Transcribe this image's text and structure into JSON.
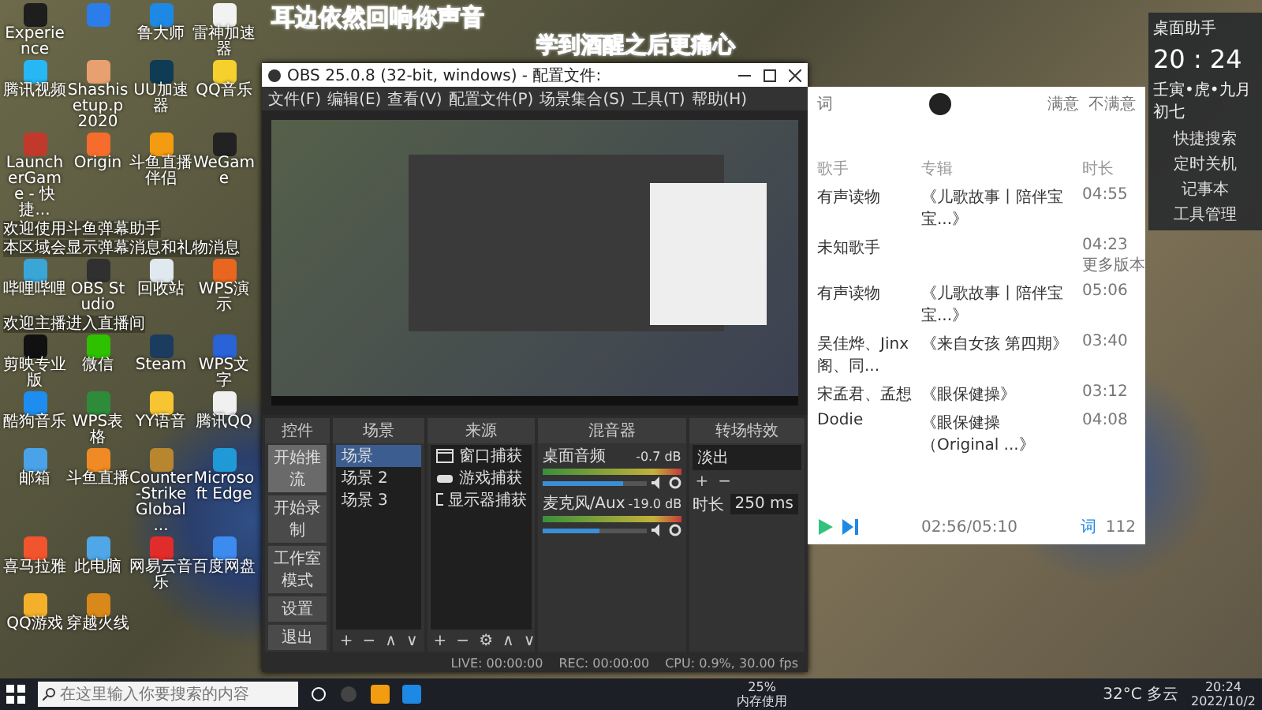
{
  "captions": [
    "耳边依然回响你声音",
    "学到酒醒之后更痛心"
  ],
  "desktop": {
    "sections": [
      {
        "kind": "icons",
        "icons": [
          {
            "label": "Experience",
            "color": "#1e1e1e"
          },
          {
            "color": "#2b7de9"
          },
          {
            "label": "鲁大师",
            "color": "#1e88e5"
          },
          {
            "label": "雷神加速器",
            "color": "#f2f2f2"
          },
          {
            "label": "腾讯视频",
            "color": "#27b7f5"
          },
          {
            "label": "Shashisetup.p 2020",
            "color": "#e8a070"
          },
          {
            "label": "UU加速器",
            "color": "#0f3b55"
          },
          {
            "label": "QQ音乐",
            "color": "#f6d12d"
          },
          {
            "label": "LauncherGame - 快捷...",
            "color": "#c0392b"
          },
          {
            "label": "Origin",
            "color": "#f56c2d"
          },
          {
            "label": "斗鱼直播伴侣",
            "color": "#f39c12"
          },
          {
            "label": "WeGame",
            "color": "#222222"
          }
        ]
      },
      {
        "kind": "notice",
        "text": "欢迎使用斗鱼弹幕助手"
      },
      {
        "kind": "notice",
        "text": "本区域会显示弹幕消息和礼物消息"
      },
      {
        "kind": "icons",
        "icons": [
          {
            "label": "哔哩哔哩",
            "color": "#3aa6d8"
          },
          {
            "label": "OBS Studio",
            "color": "#303030"
          },
          {
            "label": "回收站",
            "color": "#dfe9ef"
          },
          {
            "label": "WPS演示",
            "color": "#e8661f"
          }
        ]
      },
      {
        "kind": "notice",
        "text": "欢迎主播进入直播间"
      },
      {
        "kind": "icons",
        "icons": [
          {
            "label": "剪映专业版",
            "color": "#111111"
          },
          {
            "label": "微信",
            "color": "#2dc100"
          },
          {
            "label": "Steam",
            "color": "#1b3b5f"
          },
          {
            "label": "WPS文字",
            "color": "#2a62d8"
          },
          {
            "label": "酷狗音乐",
            "color": "#1d8df0"
          },
          {
            "label": "WPS表格",
            "color": "#2e8b3a"
          },
          {
            "label": "YY语音",
            "color": "#f7c531"
          },
          {
            "label": "腾讯QQ",
            "color": "#f0f0f0"
          },
          {
            "label": "邮箱",
            "color": "#4aa3e8"
          },
          {
            "label": "斗鱼直播",
            "color": "#f08a24"
          },
          {
            "label": "Counter-Strike Global ...",
            "color": "#b8862e"
          },
          {
            "label": "Microsoft Edge",
            "color": "#1f9ad6"
          },
          {
            "label": "喜马拉雅",
            "color": "#f2542d"
          },
          {
            "label": "此电脑",
            "color": "#4fa7e8"
          },
          {
            "label": "网易云音乐",
            "color": "#e22b2b"
          },
          {
            "label": "百度网盘",
            "color": "#3c8cf0"
          },
          {
            "label": "QQ游戏",
            "color": "#f4b02b"
          },
          {
            "label": "穿越火线",
            "color": "#d9881a"
          }
        ]
      }
    ]
  },
  "obs": {
    "title": "OBS 25.0.8 (32-bit, windows) - 配置文件:",
    "menu": [
      "文件(F)",
      "编辑(E)",
      "查看(V)",
      "配置文件(P)",
      "场景集合(S)",
      "工具(T)",
      "帮助(H)"
    ],
    "controls": {
      "title": "控件",
      "buttons": [
        {
          "label": "开始推流",
          "hovered": true
        },
        {
          "label": "开始录制",
          "hovered": false
        },
        {
          "label": "工作室模式",
          "hovered": false
        },
        {
          "label": "设置",
          "hovered": false
        },
        {
          "label": "退出",
          "hovered": false
        }
      ]
    },
    "scenes": {
      "title": "场景",
      "items": [
        {
          "label": "场景",
          "selected": true
        },
        {
          "label": "场景 2",
          "selected": false
        },
        {
          "label": "场景 3",
          "selected": false
        }
      ],
      "tools": [
        "+",
        "−",
        "∧",
        "∨"
      ]
    },
    "sources": {
      "title": "来源",
      "items": [
        {
          "label": "窗口捕获",
          "kind": "window"
        },
        {
          "label": "游戏捕获",
          "kind": "game"
        },
        {
          "label": "显示器捕获",
          "kind": "monitor"
        }
      ],
      "tools": [
        "+",
        "−",
        "⚙",
        "∧",
        "∨"
      ]
    },
    "mixer": {
      "title": "混音器",
      "channels": [
        {
          "name": "桌面音频",
          "reading": "-0.7 dB",
          "level": 0.78
        },
        {
          "name": "麦克风/Aux",
          "reading": "-19.0 dB",
          "level": 0.55
        }
      ]
    },
    "transitions": {
      "title": "转场特效",
      "value": "淡出",
      "duration_label": "时长",
      "duration": "250 ms",
      "tools": [
        "+",
        "−"
      ]
    },
    "status": [
      "LIVE: 00:00:00",
      "REC: 00:00:00",
      "CPU: 0.9%, 30.00 fps"
    ]
  },
  "music": {
    "lyrics_tab": "词",
    "feedback": [
      "满意",
      "不满意"
    ],
    "columns": [
      "歌手",
      "专辑",
      "时长"
    ],
    "rows": [
      {
        "artist": "有声读物",
        "album": "《儿歌故事丨陪伴宝宝...》",
        "duration": "04:55"
      },
      {
        "artist": "未知歌手",
        "duration": "04:23",
        "extra": "更多版本"
      },
      {
        "artist": "有声读物",
        "album": "《儿歌故事丨陪伴宝宝...》",
        "duration": "05:06"
      },
      {
        "artist": "吴佳烨、Jinx阁、同...",
        "album": "《来自女孩 第四期》",
        "duration": "03:40"
      },
      {
        "artist": "宋孟君、孟想",
        "album": "《眼保健操》",
        "duration": "03:12"
      },
      {
        "artist": "Dodie",
        "album": "《眼保健操（Original ...》",
        "duration": "04:08"
      }
    ],
    "progress": "02:56/05:10",
    "lyrics_button": "词",
    "count": "112"
  },
  "widget": {
    "title": "桌面助手",
    "time": "20 : 24",
    "date": "壬寅•虎•九月初七",
    "tools": [
      "快捷搜索",
      "定时关机",
      "记事本",
      "工具管理"
    ]
  },
  "taskbar": {
    "search_placeholder": "在这里输入你要搜索的内容",
    "memory": "25%",
    "memory_label": "内存使用",
    "weather": "32°C 多云",
    "time": "20:24",
    "date": "2022/10/2"
  }
}
